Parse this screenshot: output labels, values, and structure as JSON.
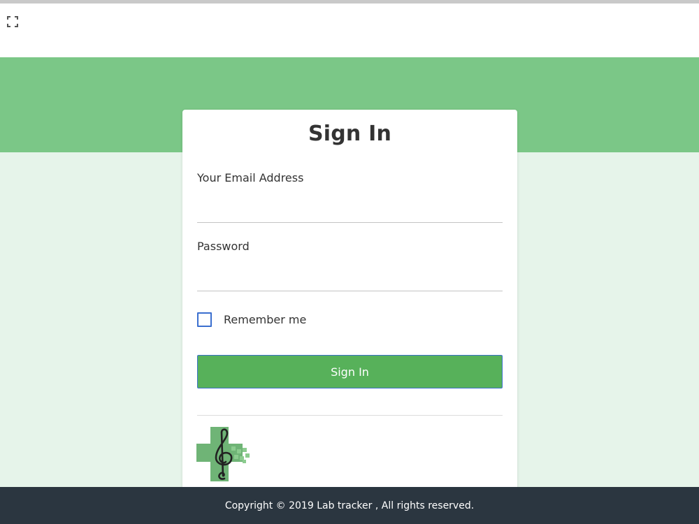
{
  "topbar": {
    "expand_icon": "fullscreen-icon"
  },
  "signin": {
    "title": "Sign In",
    "email_label": "Your Email Address",
    "email_value": "",
    "password_label": "Password",
    "password_value": "",
    "remember_label": "Remember me",
    "remember_checked": false,
    "button_label": "Sign In",
    "logo_icon": "treble-clef-cross-logo"
  },
  "footer": {
    "copyright": "Copyright © 2019 Lab tracker , All rights reserved."
  },
  "colors": {
    "hero": "#7bc787",
    "background": "#e6f4ea",
    "button": "#57b15a",
    "checkbox_border": "#3b6fcf",
    "footer": "#2b3640"
  }
}
